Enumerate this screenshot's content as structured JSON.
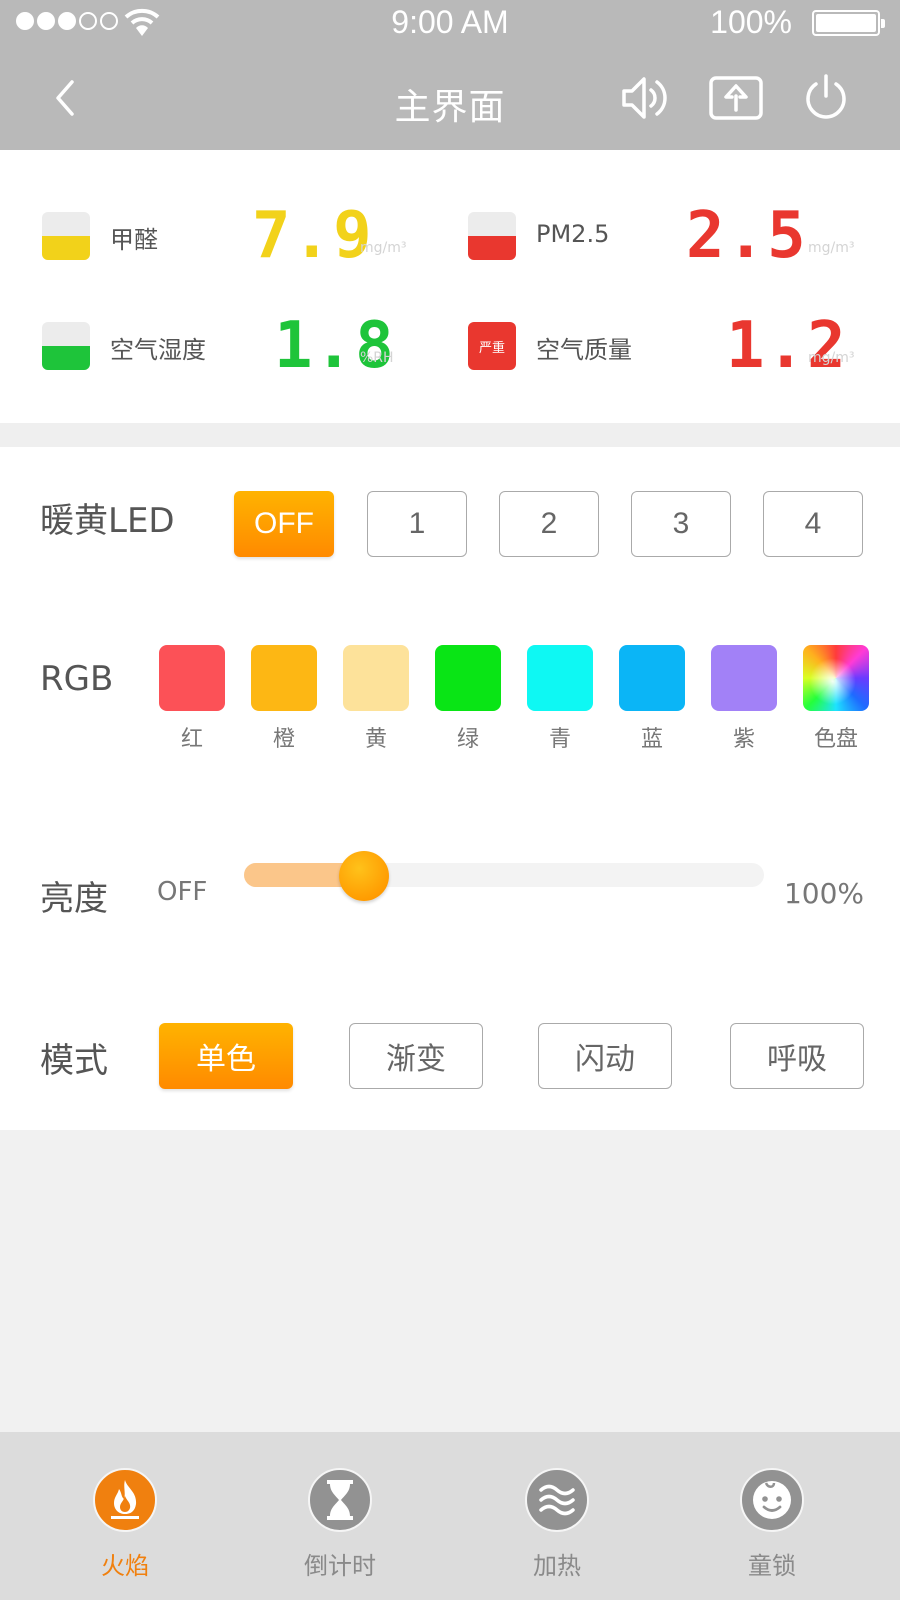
{
  "status_bar": {
    "signal_bars_filled": 3,
    "signal_bars_total": 5,
    "time": "9:00 AM",
    "battery": "100%"
  },
  "nav": {
    "title": "主界面",
    "icons": [
      "back-icon",
      "sound-icon",
      "upload-icon",
      "power-icon"
    ]
  },
  "sensors": [
    {
      "label": "甲醛",
      "value": "7.9",
      "unit": "mg/m³",
      "color": "#f2d21a",
      "indicator": "gauge"
    },
    {
      "label": "PM2.5",
      "value": "2.5",
      "unit": "mg/m³",
      "color": "#e9372f",
      "indicator": "gauge"
    },
    {
      "label": "空气湿度",
      "value": "1.8",
      "unit": "%RH",
      "color": "#1ec43a",
      "indicator": "gauge"
    },
    {
      "label": "空气质量",
      "value": "1.2",
      "unit": "mg/m³",
      "color": "#e9372f",
      "indicator": "badge",
      "badge_text": "严重"
    }
  ],
  "warm_led": {
    "label": "暖黄LED",
    "options": [
      "OFF",
      "1",
      "2",
      "3",
      "4"
    ],
    "selected": "OFF"
  },
  "rgb": {
    "label": "RGB",
    "swatches": [
      {
        "name": "红",
        "color": "#fc5157"
      },
      {
        "name": "橙",
        "color": "#fdb714"
      },
      {
        "name": "黄",
        "color": "#fde29a"
      },
      {
        "name": "绿",
        "color": "#09e515"
      },
      {
        "name": "青",
        "color": "#0ef8f3"
      },
      {
        "name": "蓝",
        "color": "#0bb5f6"
      },
      {
        "name": "紫",
        "color": "#a281f7"
      },
      {
        "name": "色盘",
        "color": "wheel"
      }
    ]
  },
  "brightness": {
    "label": "亮度",
    "min_label": "OFF",
    "max_label": "100%",
    "value_percent": 23
  },
  "mode": {
    "label": "模式",
    "options": [
      "单色",
      "渐变",
      "闪动",
      "呼吸"
    ],
    "selected": "单色"
  },
  "tabs": [
    {
      "label": "火焰",
      "icon": "flame-icon",
      "active": true
    },
    {
      "label": "倒计时",
      "icon": "hourglass-icon",
      "active": false
    },
    {
      "label": "加热",
      "icon": "heat-waves-icon",
      "active": false
    },
    {
      "label": "童锁",
      "icon": "child-face-icon",
      "active": false
    }
  ],
  "colors": {
    "accent": "#ff9a00",
    "topbar": "#b9b9b9",
    "tab_active": "#f0800f"
  }
}
